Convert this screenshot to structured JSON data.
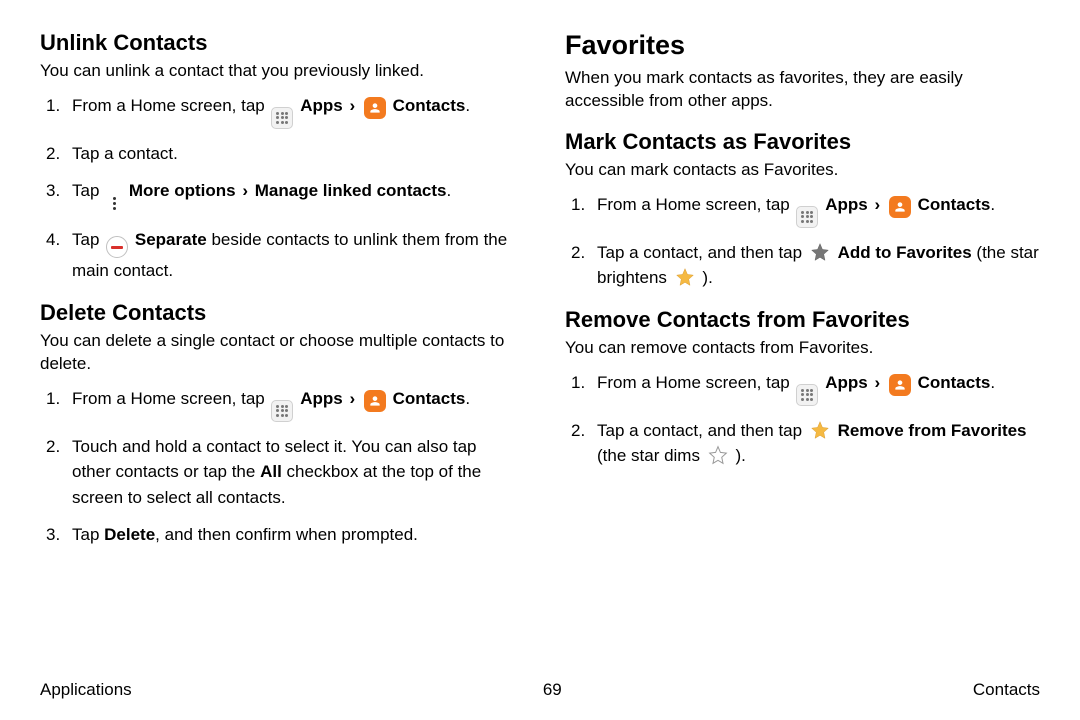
{
  "left": {
    "unlink": {
      "heading": "Unlink Contacts",
      "intro": "You can unlink a contact that you previously linked.",
      "s1a": "From a Home screen, tap ",
      "apps": "Apps",
      "contacts": "Contacts",
      "s2": "Tap a contact.",
      "s3a": "Tap ",
      "s3b": "More options",
      "s3c": "Manage linked contacts",
      "s4a": "Tap ",
      "s4b": "Separate",
      "s4c": " beside contacts to unlink them from the main contact."
    },
    "delete": {
      "heading": "Delete Contacts",
      "intro": "You can delete a single contact or choose multiple contacts to delete.",
      "s1a": "From a Home screen, tap ",
      "apps": "Apps",
      "contacts": "Contacts",
      "s2a": "Touch and hold a contact to select it. You can also tap other contacts or tap the ",
      "s2b": "All",
      "s2c": " checkbox at the top of the screen to select all contacts.",
      "s3a": "Tap ",
      "s3b": "Delete",
      "s3c": ", and then confirm when prompted."
    }
  },
  "right": {
    "fav": {
      "heading": "Favorites",
      "intro": "When you mark contacts as favorites, they are easily accessible from other apps."
    },
    "mark": {
      "heading": "Mark Contacts as Favorites",
      "intro": "You can mark contacts as Favorites.",
      "s1a": "From a Home screen, tap ",
      "apps": "Apps",
      "contacts": "Contacts",
      "s2a": "Tap a contact, and then tap ",
      "s2b": "Add to Favorites",
      "s2c": " (the star brightens ",
      "s2d": ")."
    },
    "remove": {
      "heading": "Remove Contacts from Favorites",
      "intro": "You can remove contacts from Favorites.",
      "s1a": "From a Home screen, tap ",
      "apps": "Apps",
      "contacts": "Contacts",
      "s2a": "Tap a contact, and then tap ",
      "s2b": "Remove from Favorites",
      "s2c": " (the star dims ",
      "s2d": ")."
    }
  },
  "footer": {
    "left": "Applications",
    "center": "69",
    "right": "Contacts"
  },
  "chev": "›",
  "period": "."
}
